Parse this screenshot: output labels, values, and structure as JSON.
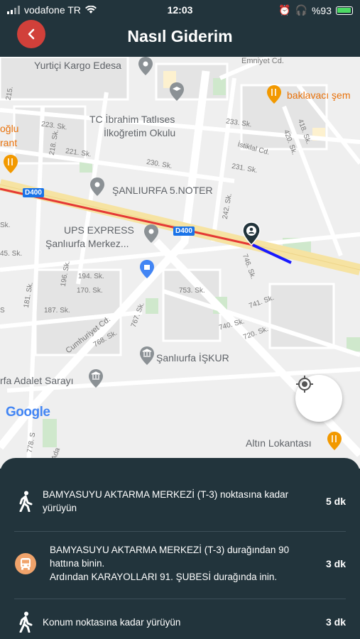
{
  "status_bar": {
    "carrier": "vodafone TR",
    "time": "12:03",
    "battery": "%93"
  },
  "header": {
    "title": "Nasıl Giderim"
  },
  "map": {
    "places": {
      "yurtici": "Yurtiçi Kargo Edesa",
      "emniyet": "Emniyet Cd.",
      "baklavaci": "baklavacı şem",
      "school_1": "TC İbrahim Tatlıses",
      "school_2": "İlkoğretim Okulu",
      "oglu": "oğlu",
      "rant": "rant",
      "noter": "ŞANLIURFA 5.NOTER",
      "ups_1": "UPS EXPRESS",
      "ups_2": "Şanlıurfa Merkez...",
      "iskur": "Şanlıurfa İŞKUR",
      "adalet": "rfa Adalet Sarayı",
      "altin": "Altın Lokantası"
    },
    "streets": {
      "s215": "215.",
      "s223": "223. Sk.",
      "s221": "221. Sk.",
      "s218": "218. Sk.",
      "s233": "233. Sk.",
      "istiklal": "İstiklal Cd.",
      "s420": "420. Sk.",
      "s418": "418. Sk.",
      "s230": "230. Sk.",
      "s231": "231. Sk.",
      "s242": "242. Sk.",
      "s194": "194. Sk.",
      "s170": "170. Sk.",
      "s196": "196. Sk.",
      "s181": "181. Sk.",
      "s187": "187. Sk.",
      "s753": "753. Sk.",
      "s746": "746. Sk.",
      "s741": "741. Sk.",
      "s740": "740. Sk.",
      "s720": "720. Sk.",
      "s767": "767. Sk.",
      "s768": "768. Sk.",
      "s778": "778. S",
      "cumhuriyet": "Cumhuriyet Cd.",
      "ada": "Ada",
      "s45": "45. Sk.",
      "sk": "Sk.",
      "s": "S"
    },
    "road_shield": "D400",
    "google": "Google",
    "colors": {
      "route_red": "#e53935",
      "route_blue": "#1a1aff",
      "highway": "#f6e3a2"
    }
  },
  "steps": [
    {
      "icon": "walk-icon",
      "text": "BAMYASUYU AKTARMA MERKEZİ (T-3) noktasına kadar yürüyün",
      "time": "5 dk"
    },
    {
      "icon": "bus-icon",
      "text_1": "BAMYASUYU AKTARMA MERKEZİ (T-3) durağından 90 hattına binin.",
      "text_2": "Ardından  KARAYOLLARI 91. ŞUBESİ durağında inin.",
      "time": "3 dk"
    },
    {
      "icon": "walk-icon",
      "text": "Konum noktasına kadar yürüyün",
      "time": "3 dk"
    }
  ]
}
